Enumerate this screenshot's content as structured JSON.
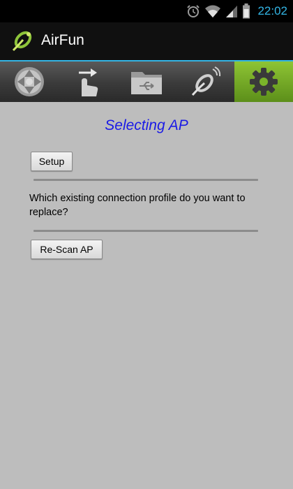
{
  "status_bar": {
    "time": "22:02",
    "icons": [
      "alarm-icon",
      "wifi-icon",
      "signal-icon",
      "battery-icon"
    ]
  },
  "action_bar": {
    "title": "AirFun",
    "logo_icon": "airfun-logo-icon"
  },
  "tabs": [
    {
      "icon": "dpad-icon",
      "active": false
    },
    {
      "icon": "touch-gesture-icon",
      "active": false
    },
    {
      "icon": "usb-folder-icon",
      "active": false
    },
    {
      "icon": "airfun-wireless-icon",
      "active": false
    },
    {
      "icon": "gear-icon",
      "active": true
    }
  ],
  "main": {
    "title": "Selecting AP",
    "setup_label": "Setup",
    "question": "Which existing connection profile do you want to replace?",
    "rescan_label": "Re-Scan AP"
  },
  "colors": {
    "title_text": "#1a1ae6",
    "active_tab": "#7ab32a",
    "accent": "#33b5e5",
    "background": "#bdbdbd"
  }
}
